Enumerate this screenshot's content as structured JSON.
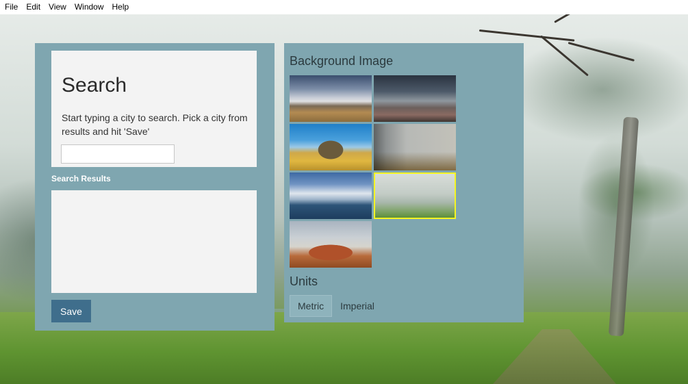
{
  "menu": [
    "File",
    "Edit",
    "View",
    "Window",
    "Help"
  ],
  "search": {
    "title": "Search",
    "description": "Start typing a city to search. Pick a city from results and hit 'Save'",
    "input_value": "",
    "input_placeholder": ""
  },
  "results": {
    "label": "Search Results",
    "items": []
  },
  "save_label": "Save",
  "background": {
    "heading": "Background Image",
    "thumbnails": [
      {
        "name": "cloudy-city-skyline",
        "selected": false
      },
      {
        "name": "stormy-city-rooftops",
        "selected": false
      },
      {
        "name": "desert-butte",
        "selected": false
      },
      {
        "name": "misty-meadow",
        "selected": false
      },
      {
        "name": "ocean-clouds",
        "selected": false
      },
      {
        "name": "foggy-forest",
        "selected": true
      },
      {
        "name": "red-rocks",
        "selected": false
      }
    ]
  },
  "units": {
    "heading": "Units",
    "options": [
      "Metric",
      "Imperial"
    ],
    "selected": "Metric"
  },
  "colors": {
    "panel": "#7fa6b0",
    "card": "#f3f3f3",
    "save_button": "#3f6e8c",
    "selected_border": "#f5f522"
  }
}
